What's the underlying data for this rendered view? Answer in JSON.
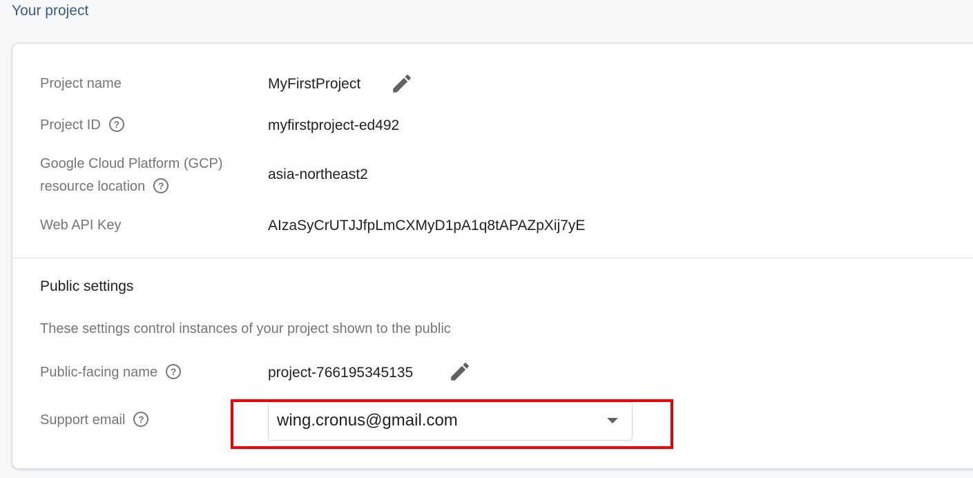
{
  "page": {
    "title": "Your project"
  },
  "project": {
    "name_label": "Project name",
    "name_value": "MyFirstProject",
    "id_label": "Project ID",
    "id_value": "myfirstproject-ed492",
    "location_label_line1": "Google Cloud Platform (GCP)",
    "location_label_line2": "resource location",
    "location_value": "asia-northeast2",
    "api_key_label": "Web API Key",
    "api_key_value": "AIzaSyCrUTJJfpLmCXMyD1pA1q8tAPAZpXij7yE"
  },
  "public_settings": {
    "title": "Public settings",
    "description": "These settings control instances of your project shown to the public",
    "public_name_label": "Public-facing name",
    "public_name_value": "project-766195345135",
    "support_email_label": "Support email",
    "support_email_value": "wing.cronus@gmail.com"
  },
  "icons": {
    "help": "?",
    "edit": "pencil-icon",
    "dropdown": "caret-down-icon"
  },
  "colors": {
    "highlight": "#ee0000",
    "title": "#3b5a86"
  }
}
